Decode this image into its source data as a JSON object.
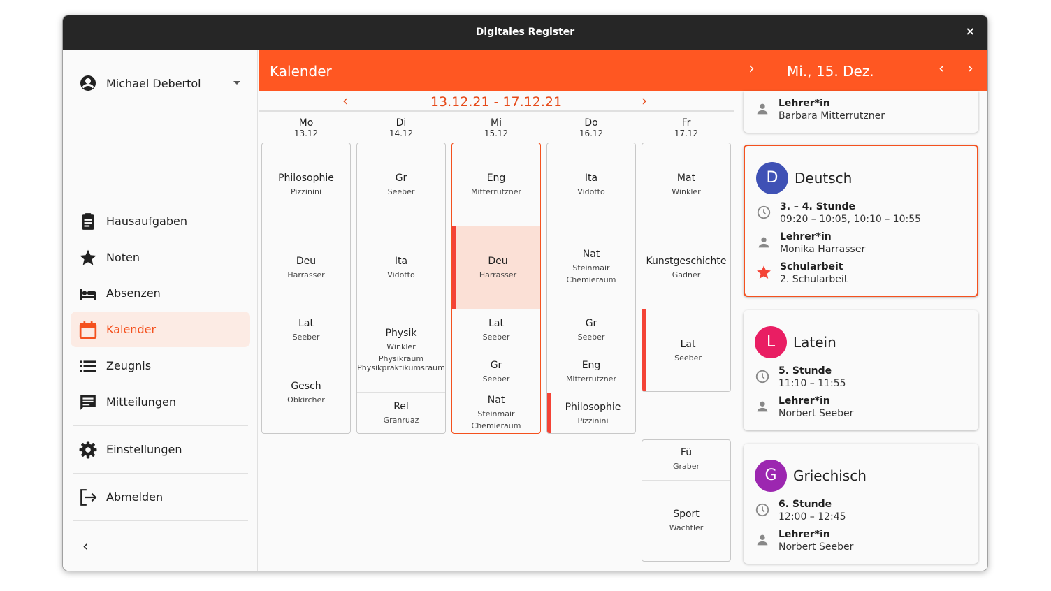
{
  "window": {
    "title": "Digitales Register",
    "close_label": "×"
  },
  "sidebar": {
    "account_name": "Michael Debertol",
    "items": [
      {
        "label": "Hausaufgaben",
        "icon": "clipboard-icon"
      },
      {
        "label": "Noten",
        "icon": "star-icon"
      },
      {
        "label": "Absenzen",
        "icon": "bed-icon"
      },
      {
        "label": "Kalender",
        "icon": "calendar-icon",
        "active": true
      },
      {
        "label": "Zeugnis",
        "icon": "list-icon"
      },
      {
        "label": "Mitteilungen",
        "icon": "message-icon"
      }
    ],
    "settings_label": "Einstellungen",
    "logout_label": "Abmelden",
    "collapse_label": "‹"
  },
  "calendar": {
    "title": "Kalender",
    "week_range": "13.12.21 - 17.12.21",
    "prev_label": "‹",
    "next_label": "›",
    "days": [
      {
        "day": "Mo",
        "date": "13.12"
      },
      {
        "day": "Di",
        "date": "14.12"
      },
      {
        "day": "Mi",
        "date": "15.12"
      },
      {
        "day": "Do",
        "date": "16.12"
      },
      {
        "day": "Fr",
        "date": "17.12"
      }
    ],
    "columns": [
      [
        {
          "subject": "Philosophie",
          "teacher": "Pizzinini"
        },
        {
          "subject": "Deu",
          "teacher": "Harrasser"
        },
        {
          "subject": "Lat",
          "teacher": "Seeber"
        },
        {
          "subject": "Gesch",
          "teacher": "Obkircher"
        }
      ],
      [
        {
          "subject": "Gr",
          "teacher": "Seeber"
        },
        {
          "subject": "Ita",
          "teacher": "Vidotto"
        },
        {
          "subject": "Physik",
          "teacher": "Winkler",
          "room": "Physikraum Physikpraktikumsraum"
        },
        {
          "subject": "Rel",
          "teacher": "Granruaz"
        }
      ],
      [
        {
          "subject": "Eng",
          "teacher": "Mitterrutzner"
        },
        {
          "subject": "Deu",
          "teacher": "Harrasser"
        },
        {
          "subject": "Lat",
          "teacher": "Seeber"
        },
        {
          "subject": "Gr",
          "teacher": "Seeber"
        },
        {
          "subject": "Nat",
          "teacher": "Steinmair",
          "room": "Chemieraum"
        }
      ],
      [
        {
          "subject": "Ita",
          "teacher": "Vidotto"
        },
        {
          "subject": "Nat",
          "teacher": "Steinmair",
          "room": "Chemieraum"
        },
        {
          "subject": "Gr",
          "teacher": "Seeber"
        },
        {
          "subject": "Eng",
          "teacher": "Mitterrutzner"
        },
        {
          "subject": "Philosophie",
          "teacher": "Pizzinini"
        }
      ],
      [
        {
          "subject": "Mat",
          "teacher": "Winkler"
        },
        {
          "subject": "Kunstgeschichte",
          "teacher": "Gadner"
        },
        {
          "subject": "Lat",
          "teacher": "Seeber"
        }
      ]
    ],
    "afternoon_fr": [
      {
        "subject": "Fü",
        "teacher": "Graber"
      },
      {
        "subject": "Sport",
        "teacher": "Wachtler"
      }
    ]
  },
  "detail": {
    "date": "Mi., 15. Dez.",
    "top_card": {
      "label": "Lehrer*in",
      "value": "Barbara Mitterrutzner"
    },
    "cards": [
      {
        "initial": "D",
        "color": "#3f51b5",
        "name": "Deutsch",
        "time_label": "3. – 4. Stunde",
        "time_value": "09:20 – 10:05, 10:10 – 10:55",
        "teacher_label": "Lehrer*in",
        "teacher_value": "Monika Harrasser",
        "extra_label": "Schularbeit",
        "extra_value": "2. Schularbeit"
      },
      {
        "initial": "L",
        "color": "#e91e63",
        "name": "Latein",
        "time_label": "5. Stunde",
        "time_value": "11:10 – 11:55",
        "teacher_label": "Lehrer*in",
        "teacher_value": "Norbert Seeber"
      },
      {
        "initial": "G",
        "color": "#9c27b0",
        "name": "Griechisch",
        "time_label": "6. Stunde",
        "time_value": "12:00 – 12:45",
        "teacher_label": "Lehrer*in",
        "teacher_value": "Norbert Seeber"
      }
    ]
  },
  "colors": {
    "accent": "#ff5722",
    "accent_dark": "#e64a19",
    "marker": "#f44336",
    "highlight": "#fbe0d6"
  }
}
